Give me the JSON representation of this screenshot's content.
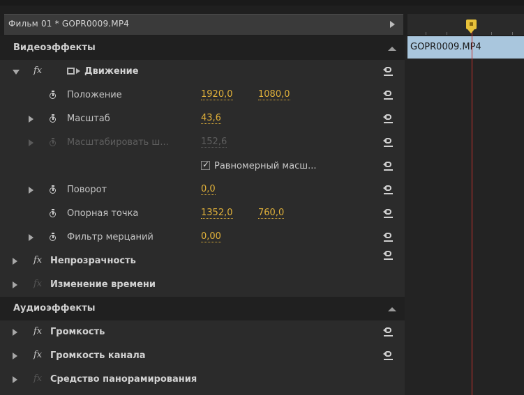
{
  "header": {
    "clip_title": "Фильм 01 * GOPR0009.MP4",
    "play_icon": "play-triangle-icon"
  },
  "sections": {
    "video": "Видеоэффекты",
    "audio": "Аудиоэффекты"
  },
  "video_effects": {
    "fx_symbol": "fx",
    "motion": {
      "name": "Движение",
      "params": [
        {
          "name": "Положение",
          "values": [
            "1920,0",
            "1080,0"
          ]
        },
        {
          "name": "Масштаб",
          "values": [
            "43,6"
          ]
        },
        {
          "name": "Масштабировать ш...",
          "values": [
            "152,6"
          ],
          "disabled": true
        },
        {
          "name": "Поворот",
          "values": [
            "0,0"
          ]
        },
        {
          "name": "Опорная точка",
          "values": [
            "1352,0",
            "760,0"
          ]
        },
        {
          "name": "Фильтр мерцаний",
          "values": [
            "0,00"
          ]
        }
      ],
      "uniform_scale": {
        "label": "Равномерный масш...",
        "checked": true
      }
    },
    "opacity": {
      "name": "Непрозрачность"
    },
    "time_remap": {
      "name": "Изменение времени",
      "disabled": true
    }
  },
  "audio_effects": {
    "volume": {
      "name": "Громкость"
    },
    "channel_volume": {
      "name": "Громкость канала"
    },
    "panner": {
      "name": "Средство панорамирования",
      "disabled": true
    }
  },
  "timeline": {
    "clip_label": "GOPR0009.MP4",
    "clip_color": "#a9c6dd",
    "playhead_color": "#e8c23a",
    "playline_color": "#c8312c"
  },
  "colors": {
    "value_color": "#e2b23a"
  }
}
